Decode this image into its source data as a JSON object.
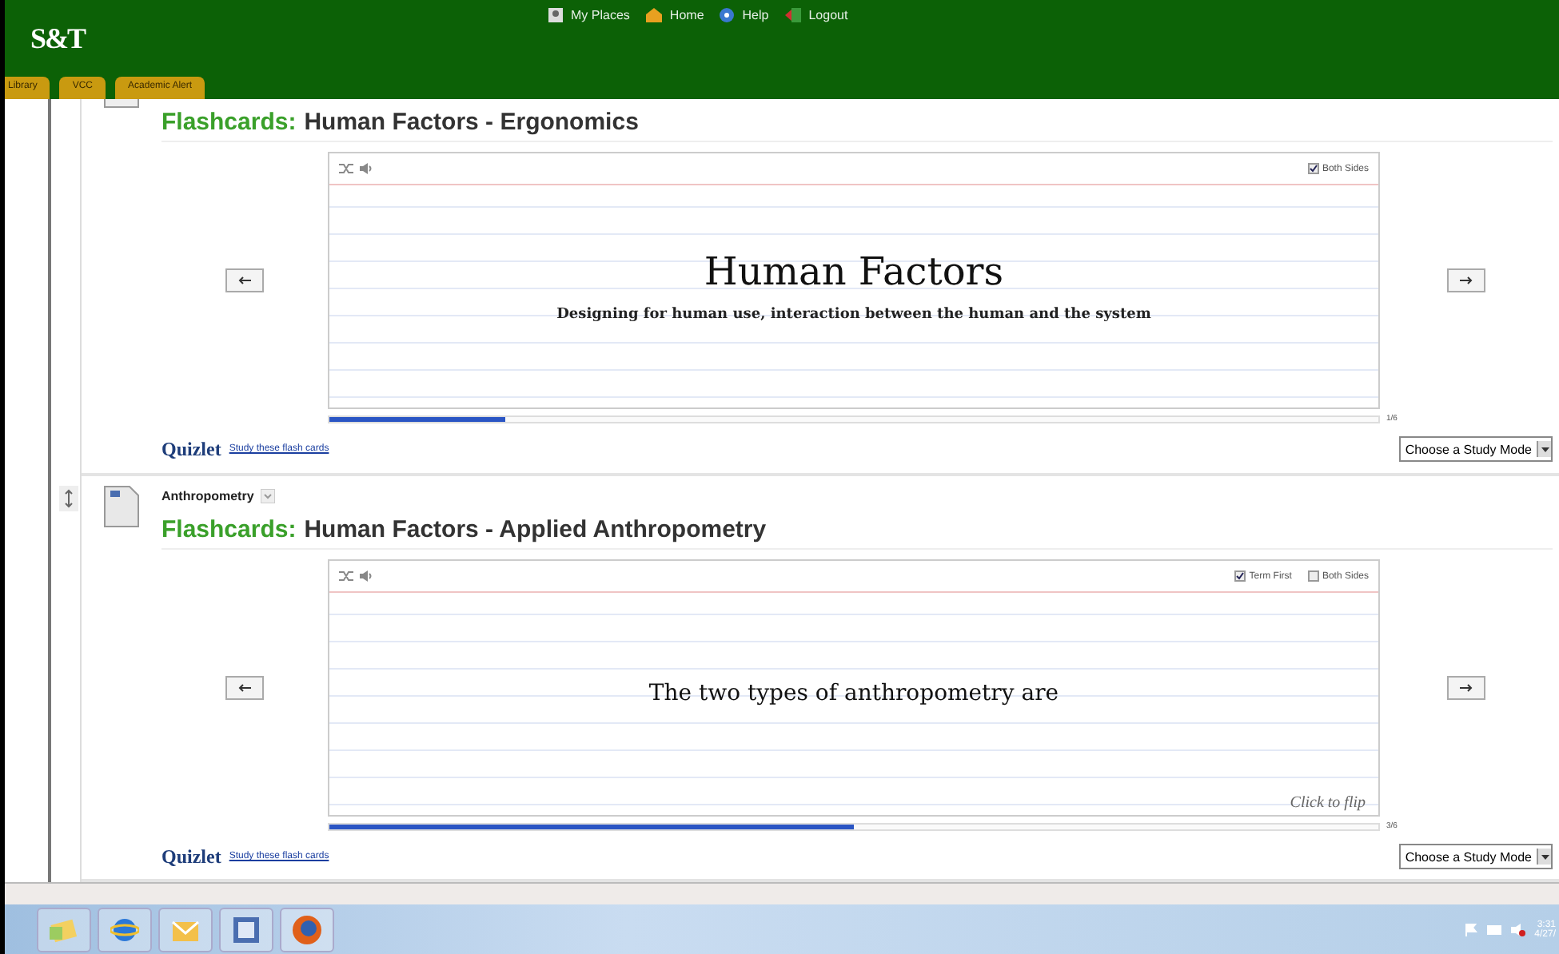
{
  "header": {
    "logo": "S&T",
    "nav": [
      {
        "kind": "person",
        "label": "My Places"
      },
      {
        "kind": "home",
        "label": "Home"
      },
      {
        "kind": "help",
        "label": "Help"
      },
      {
        "kind": "logout",
        "label": "Logout"
      }
    ],
    "tabs": [
      "Library",
      "VCC",
      "Academic Alert"
    ]
  },
  "sets": [
    {
      "title_prefix": "Flashcards:",
      "title": "Human Factors - Ergonomics",
      "options": [
        {
          "label": "Both Sides",
          "checked": true
        }
      ],
      "term": "Human Factors",
      "definition": "Designing for human use, interaction between the human and the system",
      "level": 0.167,
      "counter": "1/6",
      "brand": "Quizlet",
      "link": "Study these flash cards",
      "study_mode": "Choose a Study Mode"
    },
    {
      "label": "Anthropometry",
      "title_prefix": "Flashcards:",
      "title": "Human Factors - Applied Anthropometry",
      "options": [
        {
          "label": "Term First",
          "checked": true
        },
        {
          "label": "Both Sides",
          "checked": false
        }
      ],
      "term": "The two types of anthropometry are",
      "flip_hint": "Click to flip",
      "level": 0.5,
      "counter": "3/6",
      "brand": "Quizlet",
      "link": "Study these flash cards",
      "study_mode": "Choose a Study Mode"
    }
  ],
  "taskbar": {
    "apps": [
      {
        "kind": "folder"
      },
      {
        "kind": "browser-e"
      },
      {
        "kind": "mail"
      },
      {
        "kind": "document"
      },
      {
        "kind": "fox"
      }
    ],
    "clock": "3:31",
    "date": "4/27/"
  }
}
